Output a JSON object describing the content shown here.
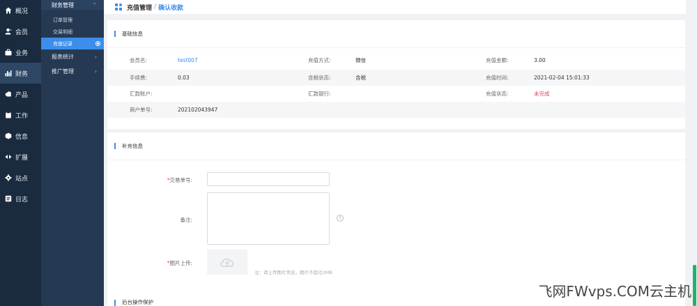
{
  "nav1": [
    {
      "label": "概况",
      "icon": "home-icon"
    },
    {
      "label": "会员",
      "icon": "user-icon"
    },
    {
      "label": "业务",
      "icon": "briefcase-icon"
    },
    {
      "label": "财务",
      "icon": "chart-icon",
      "active": true
    },
    {
      "label": "产品",
      "icon": "cloud-icon"
    },
    {
      "label": "工作",
      "icon": "clipboard-icon"
    },
    {
      "label": "信息",
      "icon": "cube-icon"
    },
    {
      "label": "扩展",
      "icon": "code-icon"
    },
    {
      "label": "站点",
      "icon": "gear-icon"
    },
    {
      "label": "日志",
      "icon": "log-icon"
    }
  ],
  "nav2": {
    "head": "财务管理",
    "subs": [
      "订单管理",
      "交易明细",
      "充值记录"
    ],
    "groups": [
      "报表统计",
      "推广管理"
    ]
  },
  "header": {
    "title": "充值管理",
    "sep": "/",
    "crumb": "确认收款"
  },
  "basic": {
    "title": "基础信息",
    "rows": [
      [
        {
          "label": "会员名:",
          "value": "test007",
          "style": "link"
        },
        {
          "label": "充值方式:",
          "value": "微信"
        },
        {
          "label": "充值金额:",
          "value": "3.00"
        }
      ],
      [
        {
          "label": "手续费:",
          "value": "0.03"
        },
        {
          "label": "含税状态:",
          "value": "含税"
        },
        {
          "label": "充值时间:",
          "value": "2021-02-04 15:01:33"
        }
      ],
      [
        {
          "label": "汇款账户:",
          "value": ""
        },
        {
          "label": "汇款银行:",
          "value": ""
        },
        {
          "label": "充值状态:",
          "value": "未完成",
          "style": "red"
        }
      ],
      [
        {
          "label": "商户单号:",
          "value": "202102043947"
        }
      ]
    ]
  },
  "supplement": {
    "title": "补充信息",
    "trade_no_label": "交易单号:",
    "note_label": "备注:",
    "image_label": "图片上传:",
    "upload_hint": "注：请上传图片凭证，图片不超过2MB",
    "help_glyph": "?"
  },
  "backend": {
    "title": "后台操作保护"
  },
  "watermark": "飞网FWvps.COM云主机"
}
